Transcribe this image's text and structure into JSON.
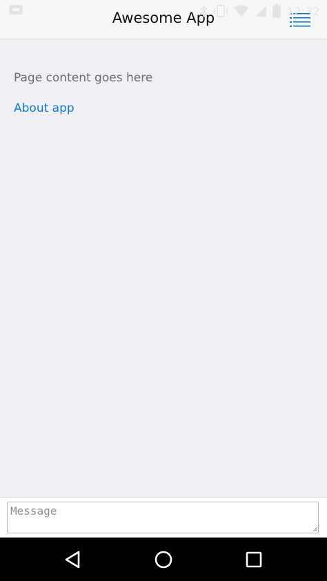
{
  "app": {
    "title": "Awesome App"
  },
  "navbar": {
    "menu_icon": "hamburger-menu-icon",
    "accent_color": "#0f7ad6"
  },
  "status_bar": {
    "time": "12:32",
    "icons": [
      "notification-icon",
      "bluetooth-icon",
      "vibrate-icon",
      "wifi-icon",
      "signal-icon",
      "battery-icon"
    ]
  },
  "content": {
    "page_text": "Page content goes here",
    "about_link": "About app"
  },
  "message": {
    "placeholder": "Message",
    "value": ""
  },
  "android_nav": {
    "buttons": [
      "back-icon",
      "home-icon",
      "recents-icon"
    ]
  },
  "colors": {
    "background": "#efeff4",
    "navbar": "#f7f7f8",
    "link": "#0f7ad6",
    "text_muted": "#6d6d72"
  }
}
